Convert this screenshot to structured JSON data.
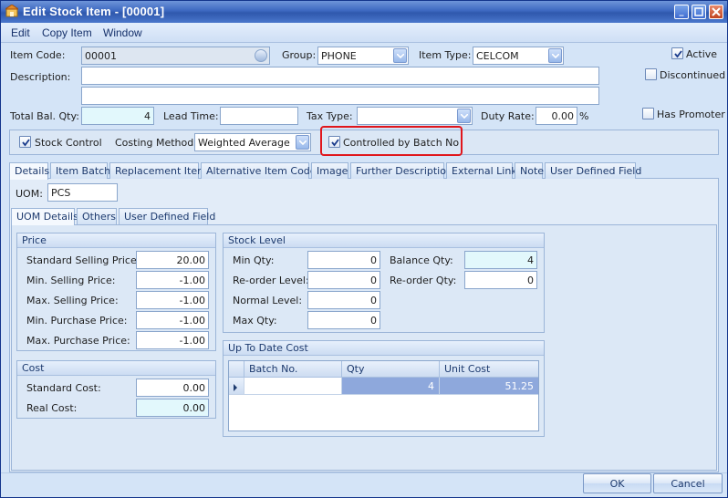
{
  "window": {
    "title": "Edit Stock Item - [00001]"
  },
  "menu": [
    "Edit",
    "Copy Item",
    "Window"
  ],
  "header": {
    "item_code_label": "Item Code:",
    "item_code": "00001",
    "group_label": "Group:",
    "group": "PHONE",
    "item_type_label": "Item Type:",
    "item_type": "CELCOM",
    "active_label": "Active",
    "active": true,
    "discontinued_label": "Discontinued",
    "discontinued": false,
    "description_label": "Description:",
    "description_1": "",
    "description_2": "",
    "total_bal_qty_label": "Total Bal. Qty:",
    "total_bal_qty": "4",
    "lead_time_label": "Lead Time:",
    "lead_time": "",
    "tax_type_label": "Tax Type:",
    "tax_type": "",
    "duty_rate_label": "Duty Rate:",
    "duty_rate": "0.00",
    "duty_rate_unit": "%",
    "has_promoter_label": "Has Promoter",
    "has_promoter": false,
    "stock_control_label": "Stock Control",
    "stock_control": true,
    "costing_method_label": "Costing Method:",
    "costing_method": "Weighted Average",
    "controlled_by_batch_label": "Controlled by Batch No",
    "controlled_by_batch": true
  },
  "main_tabs": [
    "Details",
    "Item Batch",
    "Replacement Item",
    "Alternative Item Code",
    "Image",
    "Further Description",
    "External Link",
    "Note",
    "User Defined Field"
  ],
  "uom": {
    "label": "UOM:",
    "value": "PCS"
  },
  "sub_tabs": [
    "UOM Details",
    "Others",
    "User Defined Field"
  ],
  "price": {
    "title": "Price",
    "rows": [
      {
        "label": "Standard Selling Price:",
        "value": "20.00"
      },
      {
        "label": "Min. Selling Price:",
        "value": "-1.00"
      },
      {
        "label": "Max. Selling Price:",
        "value": "-1.00"
      },
      {
        "label": "Min. Purchase Price:",
        "value": "-1.00"
      },
      {
        "label": "Max. Purchase Price:",
        "value": "-1.00"
      }
    ]
  },
  "cost": {
    "title": "Cost",
    "rows": [
      {
        "label": "Standard Cost:",
        "value": "0.00"
      },
      {
        "label": "Real Cost:",
        "value": "0.00"
      }
    ]
  },
  "stock_level": {
    "title": "Stock Level",
    "left": [
      {
        "label": "Min Qty:",
        "value": "0"
      },
      {
        "label": "Re-order Level:",
        "value": "0"
      },
      {
        "label": "Normal Level:",
        "value": "0"
      },
      {
        "label": "Max Qty:",
        "value": "0"
      }
    ],
    "right": [
      {
        "label": "Balance Qty:",
        "value": "4"
      },
      {
        "label": "Re-order Qty:",
        "value": "0"
      }
    ]
  },
  "up_to_date_cost": {
    "title": "Up To Date Cost",
    "columns": [
      "Batch No.",
      "Qty",
      "Unit Cost"
    ],
    "rows": [
      {
        "batch": "",
        "qty": "4",
        "unit_cost": "51.25"
      }
    ]
  },
  "buttons": {
    "ok": "OK",
    "cancel": "Cancel"
  },
  "colors": {
    "highlight_box": "#e0161c",
    "selected_cell": "#8ea8dc"
  }
}
